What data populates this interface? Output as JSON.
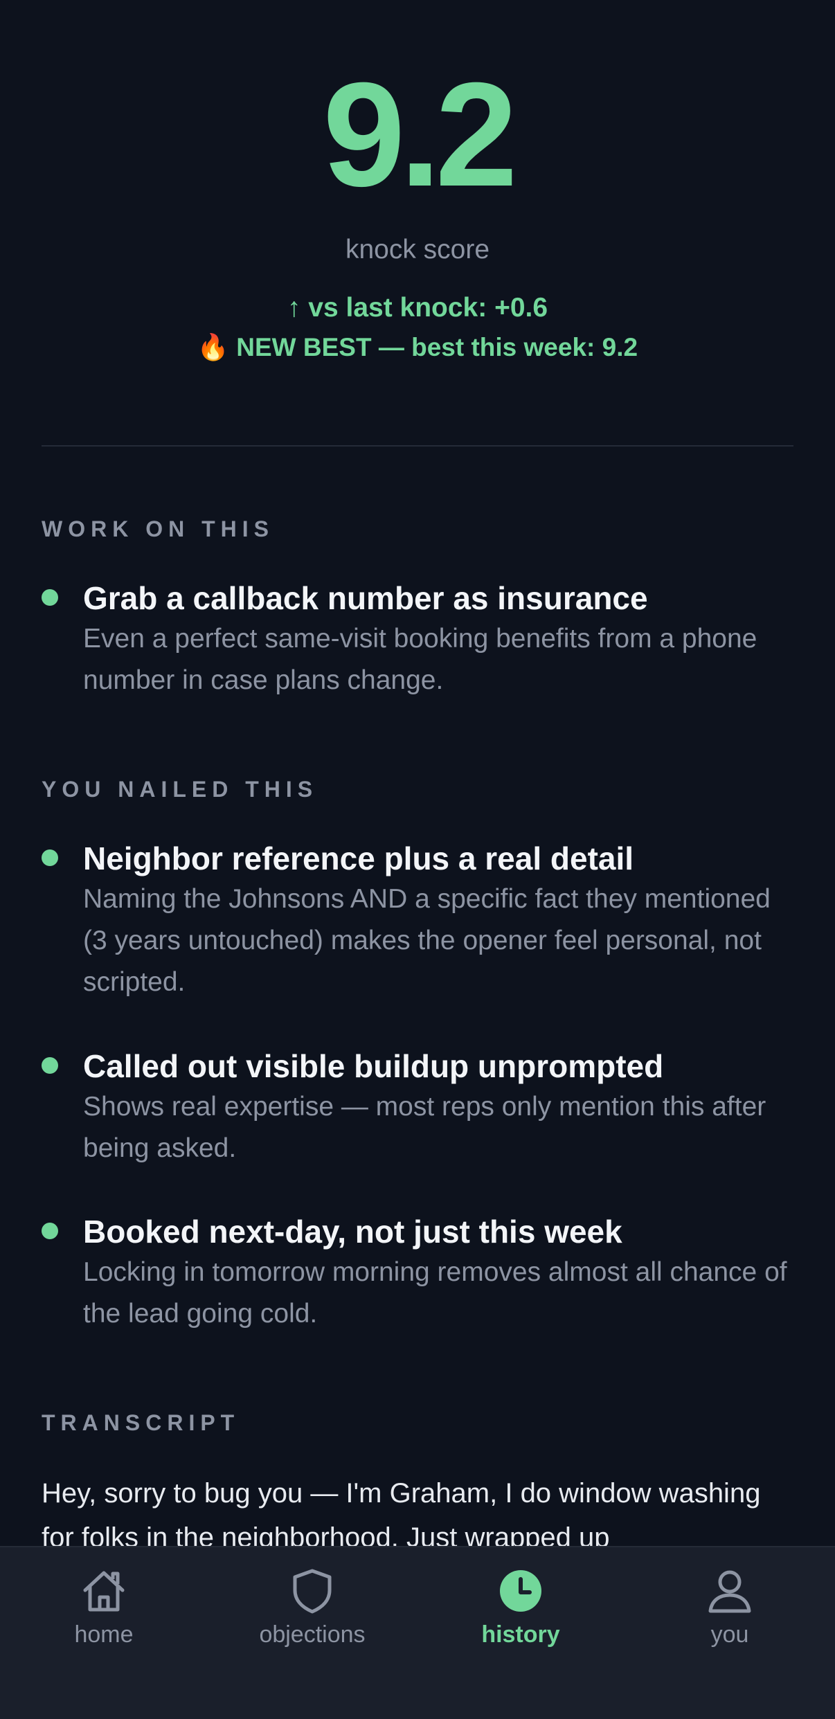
{
  "score": {
    "value": "9.2",
    "label": "knock score",
    "delta": "↑ vs last knock: +0.6",
    "best": "🔥 NEW BEST — best this week: 9.2"
  },
  "work_on_this": {
    "title": "WORK ON THIS",
    "items": [
      {
        "title": "Grab a callback number as insurance",
        "body": "Even a perfect same-visit booking benefits from a phone number in case plans change."
      }
    ]
  },
  "nailed_this": {
    "title": "YOU NAILED THIS",
    "items": [
      {
        "title": "Neighbor reference plus a real detail",
        "body": "Naming the Johnsons AND a specific fact they mentioned (3 years untouched) makes the opener feel personal, not scripted."
      },
      {
        "title": "Called out visible buildup unprompted",
        "body": "Shows real expertise — most reps only mention this after being asked."
      },
      {
        "title": "Booked next-day, not just this week",
        "body": "Locking in tomorrow morning removes almost all chance of the lead going cold."
      }
    ]
  },
  "transcript": {
    "title": "TRANSCRIPT",
    "text": "Hey, sorry to bug you — I'm Graham, I do window washing for folks in the neighborhood. Just wrapped up"
  },
  "tabs": [
    {
      "label": "home",
      "icon": "home-icon",
      "active": false
    },
    {
      "label": "objections",
      "icon": "shield-icon",
      "active": false
    },
    {
      "label": "history",
      "icon": "clock-icon",
      "active": true
    },
    {
      "label": "you",
      "icon": "person-icon",
      "active": false
    }
  ],
  "colors": {
    "background": "#0d121d",
    "accent": "#72d79a",
    "muted": "#8d94a3",
    "tabbar": "#1a1f2b"
  }
}
